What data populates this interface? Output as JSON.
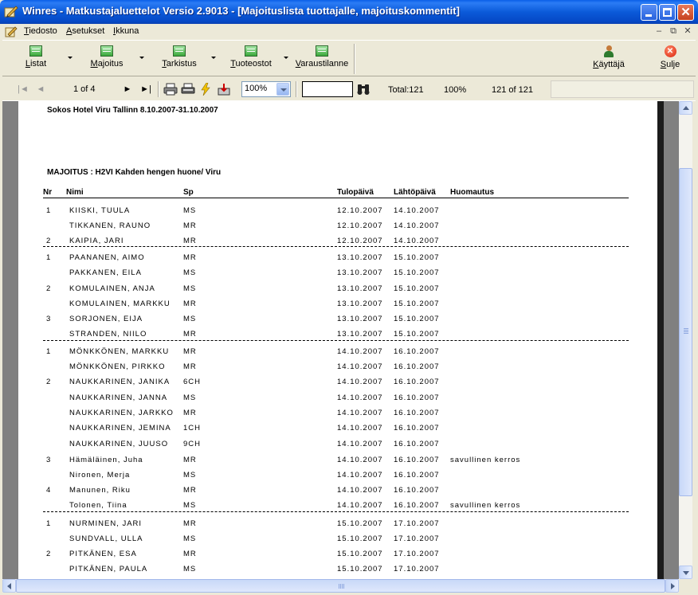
{
  "window": {
    "title": "Winres - Matkustajaluettelot Versio 2.9013 - [Majoituslista tuottajalle, majoituskommentit]",
    "min_glyph": "",
    "close_glyph": "✕"
  },
  "menu": {
    "items": [
      {
        "accel": "T",
        "rest": "iedosto"
      },
      {
        "accel": "A",
        "rest": "setukset"
      },
      {
        "accel": "I",
        "rest": "kkuna"
      }
    ],
    "mdi_min": "–",
    "mdi_restore": "⧉",
    "mdi_close": "✕"
  },
  "toolbar": {
    "buttons": [
      {
        "accel": "L",
        "rest": "istat"
      },
      {
        "accel": "M",
        "rest": "ajoitus"
      },
      {
        "accel": "T",
        "rest": "arkistus"
      },
      {
        "accel": "T",
        "rest": "uoteostot"
      },
      {
        "accel": "V",
        "rest": "araustilanne"
      }
    ],
    "user": {
      "accel": "K",
      "rest": "äyttäjä"
    },
    "close": {
      "accel": "S",
      "rest": "ulje"
    },
    "close_glyph": "✕"
  },
  "navigator": {
    "first": "|◄",
    "prev": "◄",
    "page": "1 of 4",
    "next": "►",
    "last": "►|",
    "zoom": "100%",
    "search_value": "",
    "total": "Total:121",
    "percent": "100%",
    "count": "121 of 121"
  },
  "report": {
    "title": "Sokos Hotel Viru Tallinn 8.10.2007-31.10.2007",
    "section": "MAJOITUS : H2VI Kahden hengen huone/ Viru",
    "headers": [
      "Nr",
      "Nimi",
      "Sp",
      "Tulopäivä",
      "Lähtöpäivä",
      "Huomautus"
    ],
    "rows": [
      {
        "nr": "1",
        "name": "KIISKI, TUULA",
        "sp": "MS",
        "arrive": "12.10.2007",
        "depart": "14.10.2007",
        "note": ""
      },
      {
        "nr": "",
        "name": "TIKKANEN, RAUNO",
        "sp": "MR",
        "arrive": "12.10.2007",
        "depart": "14.10.2007",
        "note": ""
      },
      {
        "nr": "2",
        "name": "KAIPIA, JARI",
        "sp": "MR",
        "arrive": "12.10.2007",
        "depart": "14.10.2007",
        "note": ""
      },
      {
        "nr": "1",
        "name": "PAANANEN, AIMO",
        "sp": "MR",
        "arrive": "13.10.2007",
        "depart": "15.10.2007",
        "note": ""
      },
      {
        "nr": "",
        "name": "PAKKANEN, EILA",
        "sp": "MS",
        "arrive": "13.10.2007",
        "depart": "15.10.2007",
        "note": ""
      },
      {
        "nr": "2",
        "name": "KOMULAINEN, ANJA",
        "sp": "MS",
        "arrive": "13.10.2007",
        "depart": "15.10.2007",
        "note": ""
      },
      {
        "nr": "",
        "name": "KOMULAINEN, MARKKU",
        "sp": "MR",
        "arrive": "13.10.2007",
        "depart": "15.10.2007",
        "note": ""
      },
      {
        "nr": "3",
        "name": "SORJONEN, EIJA",
        "sp": "MS",
        "arrive": "13.10.2007",
        "depart": "15.10.2007",
        "note": ""
      },
      {
        "nr": "",
        "name": "STRANDEN, NIILO",
        "sp": "MR",
        "arrive": "13.10.2007",
        "depart": "15.10.2007",
        "note": ""
      },
      {
        "nr": "1",
        "name": "MÖNKKÖNEN, MARKKU",
        "sp": "MR",
        "arrive": "14.10.2007",
        "depart": "16.10.2007",
        "note": ""
      },
      {
        "nr": "",
        "name": "MÖNKKÖNEN, PIRKKO",
        "sp": "MR",
        "arrive": "14.10.2007",
        "depart": "16.10.2007",
        "note": ""
      },
      {
        "nr": "2",
        "name": "NAUKKARINEN, JANIKA",
        "sp": "6CH",
        "arrive": "14.10.2007",
        "depart": "16.10.2007",
        "note": ""
      },
      {
        "nr": "",
        "name": "NAUKKARINEN, JANNA",
        "sp": "MS",
        "arrive": "14.10.2007",
        "depart": "16.10.2007",
        "note": ""
      },
      {
        "nr": "",
        "name": "NAUKKARINEN, JARKKO",
        "sp": "MR",
        "arrive": "14.10.2007",
        "depart": "16.10.2007",
        "note": ""
      },
      {
        "nr": "",
        "name": "NAUKKARINEN, JEMINA",
        "sp": "1CH",
        "arrive": "14.10.2007",
        "depart": "16.10.2007",
        "note": ""
      },
      {
        "nr": "",
        "name": "NAUKKARINEN, JUUSO",
        "sp": "9CH",
        "arrive": "14.10.2007",
        "depart": "16.10.2007",
        "note": ""
      },
      {
        "nr": "3",
        "name": "Hämäläinen, Juha",
        "sp": "MR",
        "arrive": "14.10.2007",
        "depart": "16.10.2007",
        "note": "savullinen kerros"
      },
      {
        "nr": "",
        "name": "Nironen, Merja",
        "sp": "MS",
        "arrive": "14.10.2007",
        "depart": "16.10.2007",
        "note": ""
      },
      {
        "nr": "4",
        "name": "Manunen, Riku",
        "sp": "MR",
        "arrive": "14.10.2007",
        "depart": "16.10.2007",
        "note": ""
      },
      {
        "nr": "",
        "name": "Tolonen, Tiina",
        "sp": "MS",
        "arrive": "14.10.2007",
        "depart": "16.10.2007",
        "note": "savullinen kerros"
      },
      {
        "nr": "1",
        "name": "NURMINEN, JARI",
        "sp": "MR",
        "arrive": "15.10.2007",
        "depart": "17.10.2007",
        "note": ""
      },
      {
        "nr": "",
        "name": "SUNDVALL, ULLA",
        "sp": "MS",
        "arrive": "15.10.2007",
        "depart": "17.10.2007",
        "note": ""
      },
      {
        "nr": "2",
        "name": "PITKÄNEN, ESA",
        "sp": "MR",
        "arrive": "15.10.2007",
        "depart": "17.10.2007",
        "note": ""
      },
      {
        "nr": "",
        "name": "PITKÄNEN, PAULA",
        "sp": "MS",
        "arrive": "15.10.2007",
        "depart": "17.10.2007",
        "note": ""
      }
    ]
  }
}
